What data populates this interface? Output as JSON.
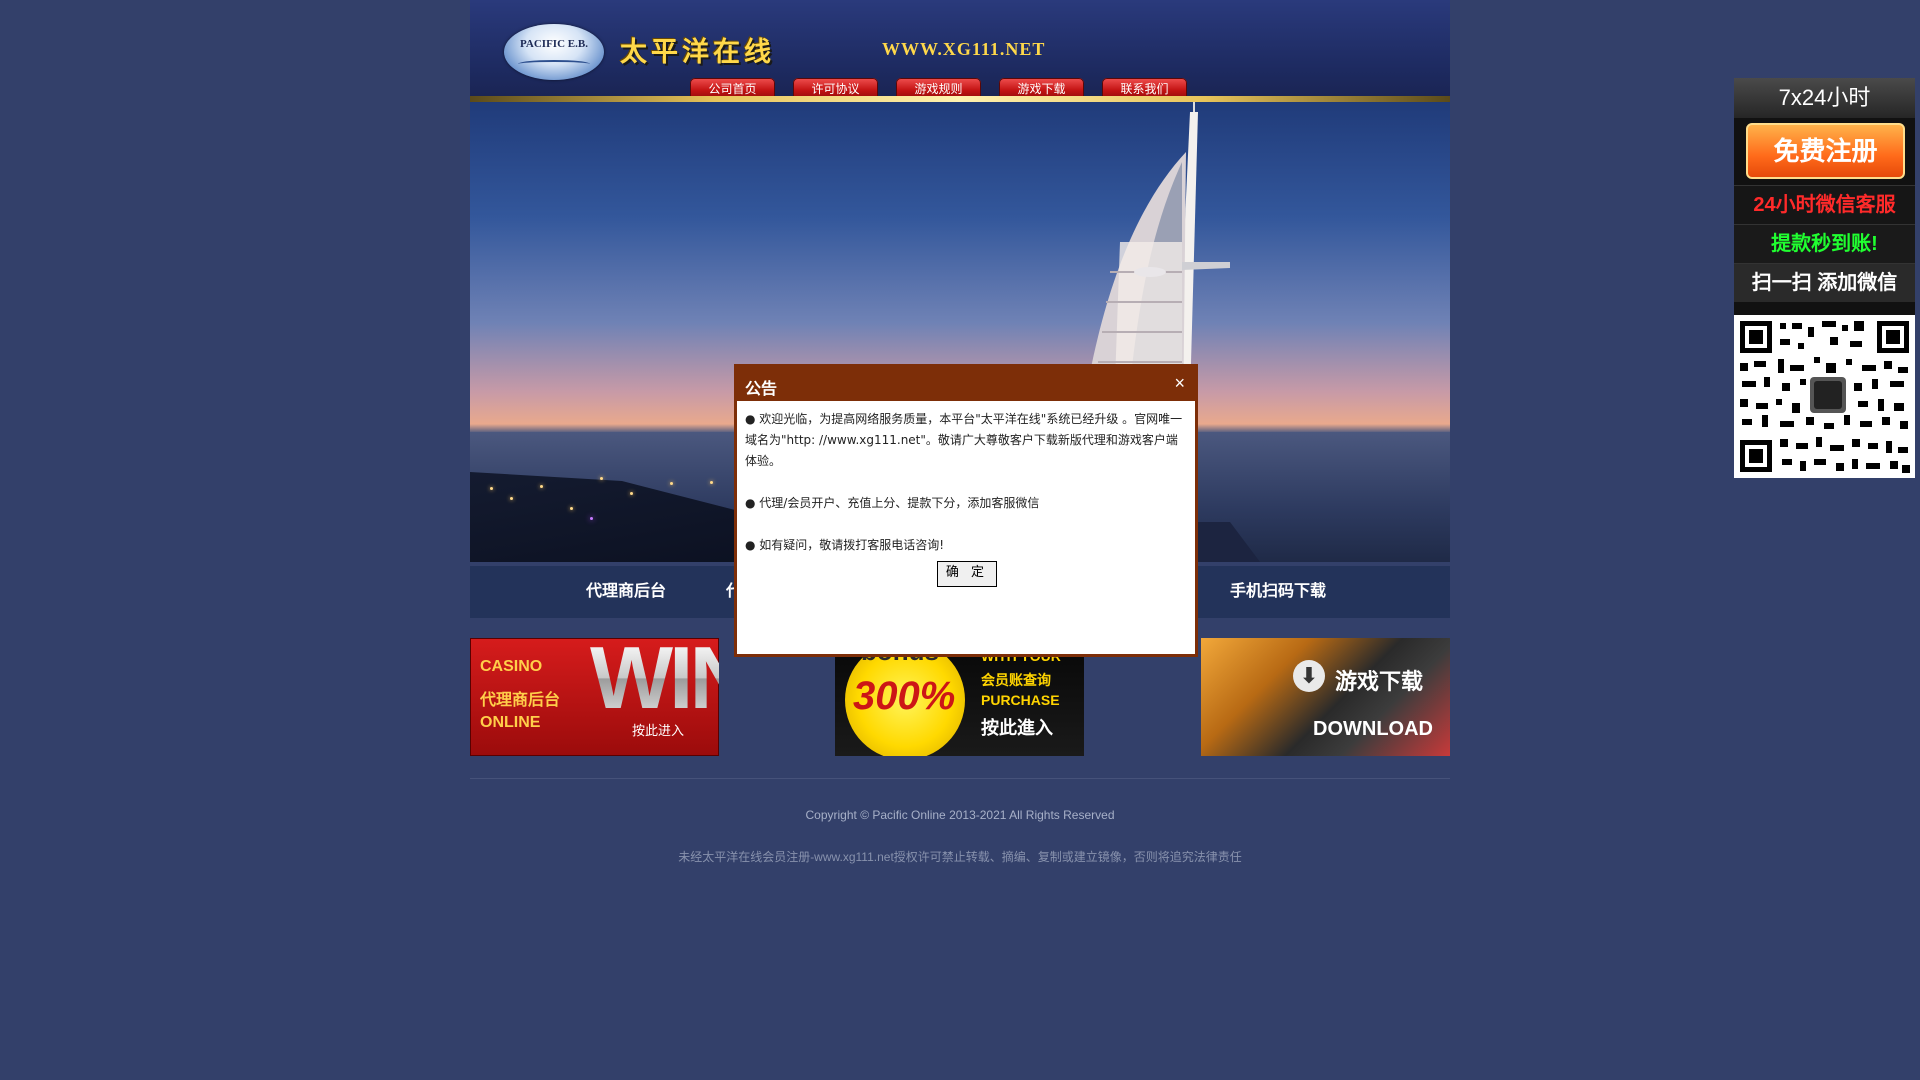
{
  "header": {
    "logo_text": "PACIFIC E.B.",
    "site_name": "太平洋在线",
    "site_url": "WWW.XG111.NET"
  },
  "nav": [
    {
      "label": "公司首页"
    },
    {
      "label": "许可协议"
    },
    {
      "label": "游戏规则"
    },
    {
      "label": "游戏下载"
    },
    {
      "label": "联系我们"
    }
  ],
  "bluebar": {
    "left_label": "代理商后台",
    "left_partial": "代",
    "right_label": "手机扫码下载"
  },
  "promos": {
    "casino": {
      "line1": "CASINO",
      "line2": "代理商后台",
      "line3": "ONLINE",
      "big": "WIN",
      "enter": "按此进入"
    },
    "bonus": {
      "word": "bonus",
      "pct": "300%",
      "r1": "WITH YOUR",
      "r2": "会员账查询",
      "r3": "PURCHASE",
      "r4": "按此進入"
    },
    "download": {
      "cn": "游戏下载",
      "en": "DOWNLOAD"
    }
  },
  "footer": {
    "copyright": "Copyright © Pacific Online 2013-2021 All Rights Reserved",
    "disclaimer": "未经太平洋在线会员注册-www.xg111.net授权许可禁止转载、摘编、复制或建立镜像，否则将追究法律责任"
  },
  "side_ad": {
    "top_label": "7x24小时",
    "register_button": "免费注册",
    "line1": "24小时微信客服",
    "line2": "提款秒到账!",
    "line3": "扫一扫 添加微信"
  },
  "modal": {
    "title": "公告",
    "close": "×",
    "para1": "● 欢迎光临，为提高网络服务质量，本平台\"太平洋在线\"系统已经升级 。官网唯一域名为\"http: //www.xg111.net\"。敬请广大尊敬客户下载新版代理和游戏客户端体验。",
    "para2": "● 代理/会员开户、充值上分、提款下分，添加客服微信",
    "para3": "● 如有疑问，敬请拨打客服电话咨询!",
    "ok_button": "确 定"
  },
  "colors": {
    "page_bg": "#33406a",
    "modal_border": "#7d2e08",
    "nav_red": "#c41414",
    "gold": "#ffd84a"
  }
}
